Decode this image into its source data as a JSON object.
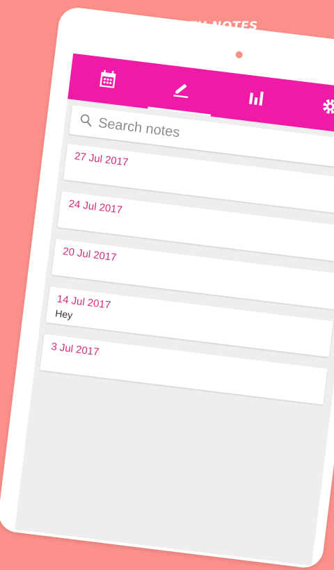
{
  "headline": "PERSONAL HEALTH NOTES",
  "colors": {
    "background": "#fb8f89",
    "tabbar": "#ef1aa6",
    "date": "#d42e7b"
  },
  "tabs": [
    {
      "icon": "calendar-icon",
      "active": false
    },
    {
      "icon": "pencil-icon",
      "active": true
    },
    {
      "icon": "bar-chart-icon",
      "active": false
    },
    {
      "icon": "gear-icon",
      "active": false
    }
  ],
  "search": {
    "placeholder": "Search notes",
    "icon": "search-icon"
  },
  "notes": [
    {
      "date": "27 Jul 2017",
      "text": ""
    },
    {
      "date": "24 Jul 2017",
      "text": ""
    },
    {
      "date": "20 Jul 2017",
      "text": ""
    },
    {
      "date": "14 Jul 2017",
      "text": "Hey"
    },
    {
      "date": "3 Jul 2017",
      "text": ""
    }
  ]
}
